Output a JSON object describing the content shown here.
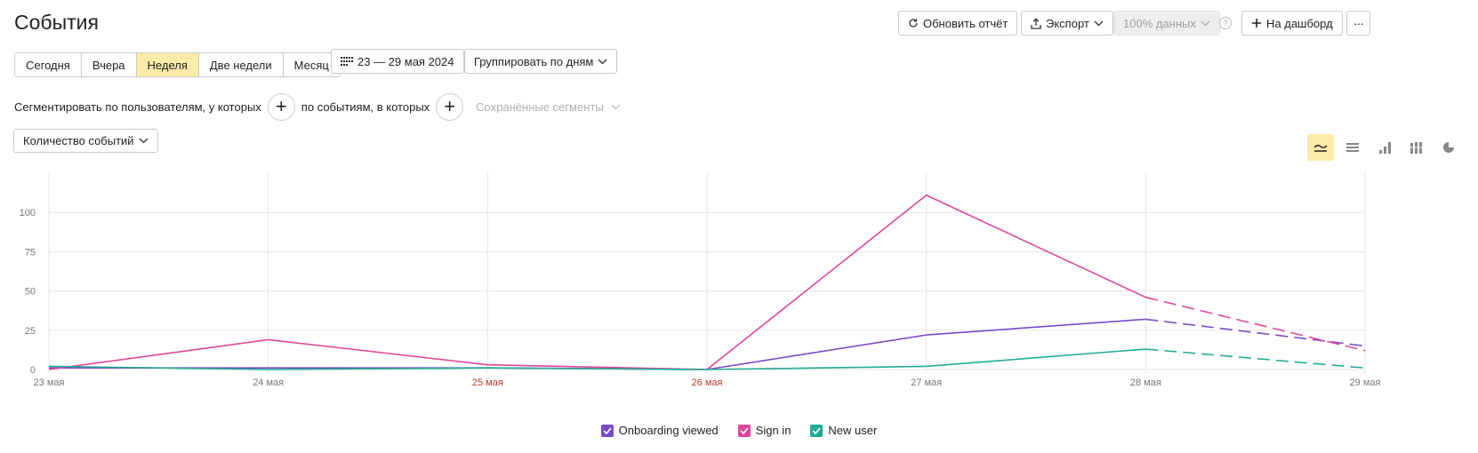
{
  "page": {
    "title": "События"
  },
  "toolbar": {
    "refresh_label": "Обновить отчёт",
    "export_label": "Экспорт",
    "data_pct_label": "100% данных",
    "help_label": "?",
    "dashboard_label": "На дашборд",
    "more_label": "···"
  },
  "periods": [
    {
      "label": "Сегодня",
      "active": false
    },
    {
      "label": "Вчера",
      "active": false
    },
    {
      "label": "Неделя",
      "active": true
    },
    {
      "label": "Две недели",
      "active": false
    },
    {
      "label": "Месяц",
      "active": false
    }
  ],
  "date_range": {
    "label": "23 — 29 мая 2024"
  },
  "group_by": {
    "label": "Группировать по дням"
  },
  "segmentation": {
    "users_label": "Сегментировать по пользователям, у которых",
    "events_label": "по событиям, в которых",
    "saved_label": "Сохранённые сегменты"
  },
  "metric_select": {
    "label": "Количество событий"
  },
  "view_modes": [
    "line-chart-icon",
    "area-chart-icon",
    "bar-chart-icon",
    "stacked-bar-icon",
    "pie-chart-icon"
  ],
  "chart_data": {
    "type": "line",
    "x": [
      "23 мая",
      "24 мая",
      "25 мая",
      "26 мая",
      "27 мая",
      "28 мая",
      "29 мая"
    ],
    "weekend_x": [
      "25 мая",
      "26 мая"
    ],
    "yticks": [
      0,
      25,
      50,
      75,
      100
    ],
    "ylim": [
      0,
      125
    ],
    "dashed_from_index": 5,
    "grid": true,
    "legend_position": "bottom",
    "series": [
      {
        "name": "Onboarding viewed",
        "color": "#7b49c9",
        "values": [
          1,
          1,
          1,
          0,
          22,
          32,
          15
        ]
      },
      {
        "name": "Sign in",
        "color": "#e0469c",
        "values": [
          0,
          19,
          3,
          0,
          111,
          46,
          12
        ]
      },
      {
        "name": "New user",
        "color": "#22ab94",
        "values": [
          2,
          0,
          1,
          0,
          2,
          13,
          1
        ]
      }
    ]
  }
}
